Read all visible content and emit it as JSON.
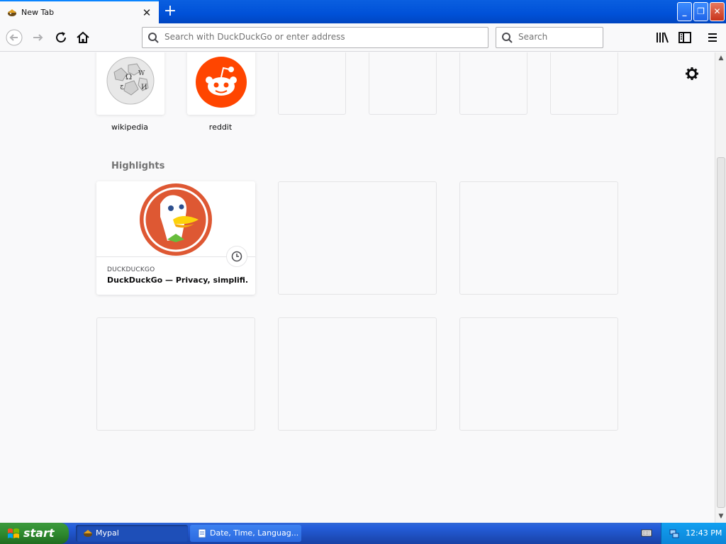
{
  "browser": {
    "tab": {
      "title": "New Tab",
      "close_label": "✕"
    },
    "new_tab_label": "+",
    "window_buttons": {
      "minimize": "_",
      "maximize": "❐",
      "close": "✕"
    },
    "urlbar": {
      "placeholder": "Search with DuckDuckGo or enter address",
      "value": ""
    },
    "searchbar": {
      "placeholder": "Search",
      "value": ""
    }
  },
  "newtab": {
    "top_sites": [
      {
        "label": "wikipedia",
        "icon": "wikipedia-icon"
      },
      {
        "label": "reddit",
        "icon": "reddit-icon"
      },
      {
        "label": ""
      },
      {
        "label": ""
      },
      {
        "label": ""
      },
      {
        "label": ""
      }
    ],
    "highlights": {
      "title": "Highlights",
      "cards": [
        {
          "source": "DUCKDUCKGO",
          "title": "DuckDuckGo — Privacy, simplifi...",
          "icon": "duckduckgo-icon"
        }
      ]
    }
  },
  "taskbar": {
    "start_label": "start",
    "tasks": [
      {
        "label": "Mypal",
        "active": true
      },
      {
        "label": "Date, Time, Languag...",
        "active": false
      }
    ],
    "clock": "12:43 PM"
  },
  "colors": {
    "accent": "#0a84ff",
    "reddit": "#ff4500",
    "duckduckgo": "#de5833",
    "taskbar": "#245edb",
    "start": "#2f8a2f"
  }
}
